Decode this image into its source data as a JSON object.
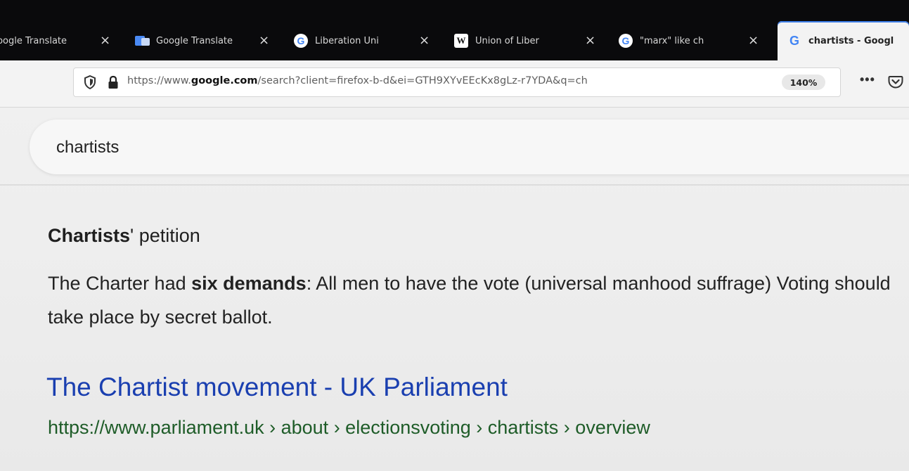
{
  "browser": {
    "tabs": [
      {
        "title": "Google Translate",
        "close": "×",
        "icon": "google-translate-icon"
      },
      {
        "title": "Google Translate",
        "close": "×",
        "icon": "google-translate-icon"
      },
      {
        "title": "Liberation Uni",
        "close": "×",
        "icon": "google-icon"
      },
      {
        "title": "Union of Liber",
        "close": "×",
        "icon": "wikipedia-icon"
      },
      {
        "title": "\"marx\" like ch",
        "close": "×",
        "icon": "google-icon"
      },
      {
        "title": "chartists - Googl",
        "close": "",
        "icon": "google-icon",
        "active": true
      }
    ],
    "url": {
      "prefix": "https://www.",
      "host": "google.com",
      "path": "/search?client=firefox-b-d&ei=GTH9XYvEEcKx8gLz-r7YDA&q=ch"
    },
    "zoom": "140%",
    "menu_label": "•••"
  },
  "search": {
    "query": "chartists"
  },
  "featured_snippet": {
    "heading_bold": "Chartists",
    "heading_rest": "' petition",
    "text_before": "The Charter had ",
    "text_bold": "six demands",
    "text_after": ": All men to have the vote (universal manhood suffrage) Voting should take place by secret ballot."
  },
  "result": {
    "title": "The Chartist movement - UK Parliament",
    "breadcrumb": "https://www.parliament.uk › about › electionsvoting › chartists › overview"
  },
  "colors": {
    "tabstrip_bg": "#0a0a0c",
    "link_blue": "#1a3fb0",
    "url_green": "#1e5c28",
    "google_blue": "#4285f4"
  }
}
